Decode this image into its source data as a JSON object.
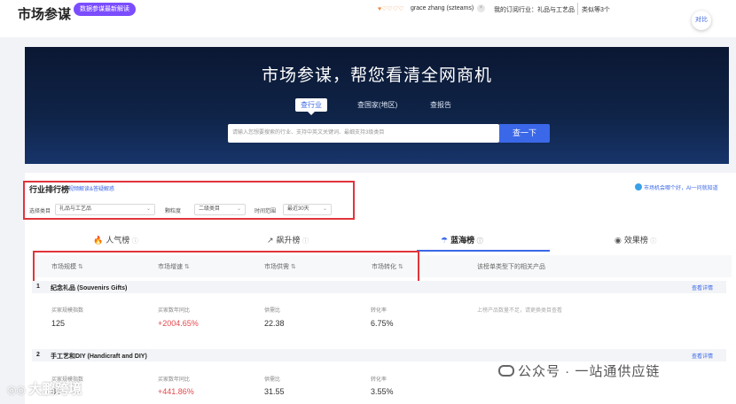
{
  "header": {
    "logo": "市场参谋",
    "badge": "数据参谋最新解读",
    "user": "grace zhang (szteams)",
    "subscribed": "我的订阅行业：礼品与工艺品",
    "compare_count": "类似等3个",
    "compare_btn": "对比"
  },
  "hero": {
    "title": "市场参谋，帮您看清全网商机",
    "tabs": [
      "查行业",
      "查国家(地区)",
      "查报告"
    ],
    "search_placeholder": "请输入您想要搜索的行业、支持中英文关键词、最细支持3级类目",
    "search_button": "查一下"
  },
  "ranking": {
    "title": "行业排行榜",
    "help_link": "视频解读&答疑解惑",
    "ai_link": "市场机会哪个好，AI一问就知道",
    "filters": {
      "category_label": "选择类目",
      "category_value": "礼品与工艺品",
      "granularity_label": "颗粒度",
      "granularity_value": "二级类目",
      "time_label": "时间范围",
      "time_value": "最近30天"
    },
    "tabs": [
      "人气榜",
      "飙升榜",
      "蓝海榜",
      "效果榜"
    ],
    "columns": [
      "市场规模",
      "市场增速",
      "市场供需",
      "市场转化",
      "该榜单类型下的相关产品"
    ],
    "items": [
      {
        "rank": "1",
        "name": "纪念礼品 (Souvenirs Gifts)",
        "link": "查看详情",
        "metrics": [
          {
            "label": "买家规模指数",
            "value": "125"
          },
          {
            "label": "买家数年同比",
            "value": "+2004.65%"
          },
          {
            "label": "供需比",
            "value": "22.38"
          },
          {
            "label": "转化率",
            "value": "6.75%"
          }
        ],
        "note": "上榜产品数量不足，请更换类目查看"
      },
      {
        "rank": "2",
        "name": "手工艺和DIY (Handicraft and DIY)",
        "link": "查看详情",
        "metrics": [
          {
            "label": "买家规模指数",
            "value": "84"
          },
          {
            "label": "买家数年同比",
            "value": "+441.86%"
          },
          {
            "label": "供需比",
            "value": "31.55"
          },
          {
            "label": "转化率",
            "value": "3.55%"
          }
        ]
      }
    ]
  },
  "watermark": {
    "right": "公众号 · 一站通供应链",
    "left": "大鹏跨境"
  }
}
